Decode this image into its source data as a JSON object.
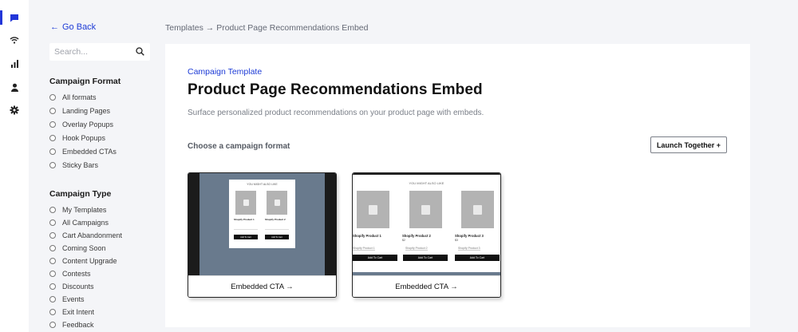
{
  "rail": {
    "items": [
      {
        "icon": "chat-icon",
        "active": true
      },
      {
        "icon": "wifi-icon",
        "active": false
      },
      {
        "icon": "bar-chart-icon",
        "active": false
      },
      {
        "icon": "user-icon",
        "active": false
      },
      {
        "icon": "gear-icon",
        "active": false
      }
    ]
  },
  "sidebar": {
    "back_label": "Go Back",
    "search_placeholder": "Search...",
    "format_title": "Campaign Format",
    "formats": [
      "All formats",
      "Landing Pages",
      "Overlay Popups",
      "Hook Popups",
      "Embedded CTAs",
      "Sticky Bars"
    ],
    "type_title": "Campaign Type",
    "types": [
      "My Templates",
      "All Campaigns",
      "Cart Abandonment",
      "Coming Soon",
      "Content Upgrade",
      "Contests",
      "Discounts",
      "Events",
      "Exit Intent",
      "Feedback"
    ]
  },
  "breadcrumb": "Templates → Product Page Recommendations Embed",
  "main": {
    "eyebrow": "Campaign Template",
    "title": "Product Page Recommendations Embed",
    "description": "Surface personalized product recommendations on your product page with embeds.",
    "choose_label": "Choose a campaign format",
    "launch_label": "Launch Together +"
  },
  "tiles": [
    {
      "caption": "Embedded CTA →",
      "preview": {
        "heading": "YOU MIGHT ALSO LIKE",
        "products": [
          {
            "name": "Shopify Product 1",
            "button": "Add To Cart"
          },
          {
            "name": "Shopify Product 2",
            "button": "Add To Cart"
          }
        ]
      }
    },
    {
      "caption": "Embedded CTA →",
      "preview": {
        "heading": "YOU MIGHT ALSO LIKE",
        "products": [
          {
            "name": "Shopify Product 1",
            "price": "$1",
            "select": "Shopify Product 1",
            "button": "Add To Cart"
          },
          {
            "name": "Shopify Product 2",
            "price": "$2",
            "select": "Shopify Product 2",
            "button": "Add To Cart"
          },
          {
            "name": "Shopify Product 3",
            "price": "$3",
            "select": "Shopify Product 3",
            "button": "Add To Cart"
          }
        ]
      }
    }
  ],
  "colors": {
    "accent": "#1d3bd6",
    "background": "#f4f5f8",
    "preview_slate": "#697a8d"
  }
}
